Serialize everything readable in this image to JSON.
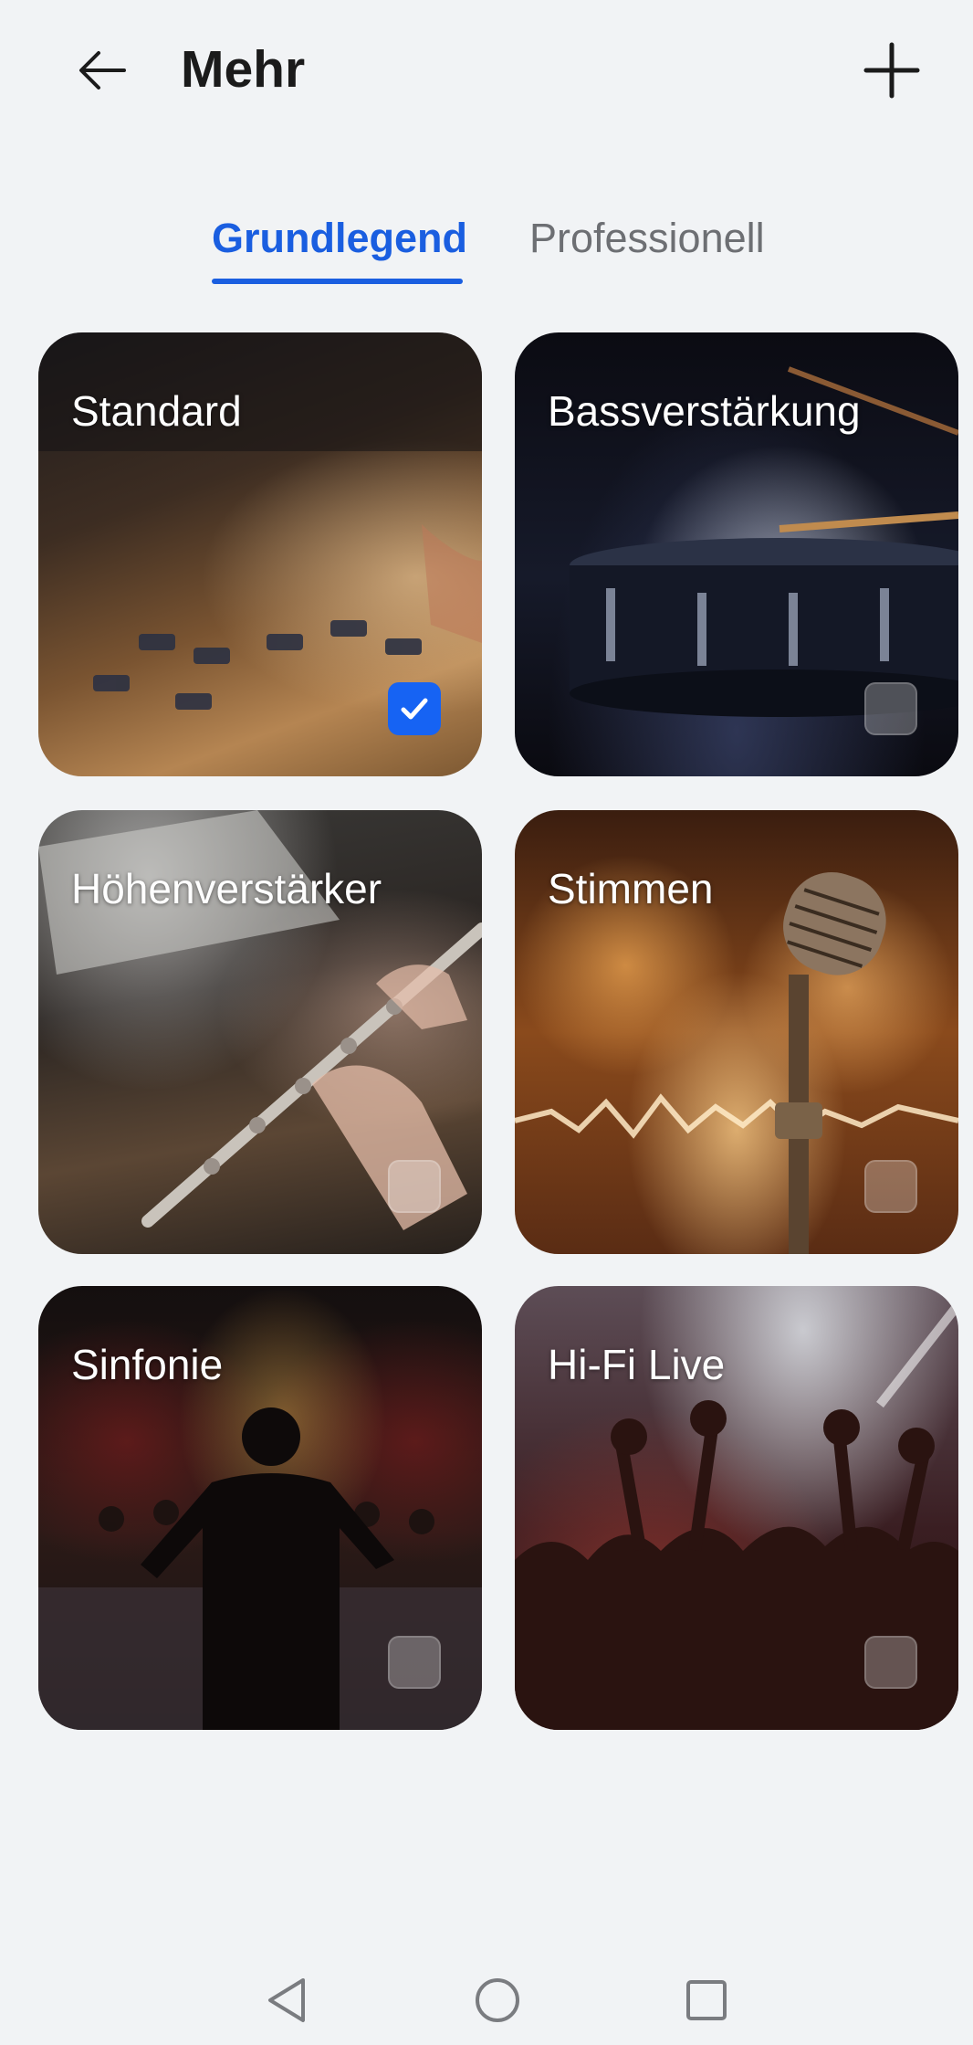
{
  "header": {
    "title": "Mehr",
    "back_icon": "arrow-left-icon",
    "add_icon": "plus-icon"
  },
  "tabs": [
    {
      "label": "Grundlegend",
      "active": true
    },
    {
      "label": "Professionell",
      "active": false
    }
  ],
  "colors": {
    "accent": "#1a5ee0",
    "background": "#f1f3f5",
    "checkbox_active": "#1663f3"
  },
  "presets": [
    {
      "label": "Standard",
      "selected": true
    },
    {
      "label": "Bassverstärkung",
      "selected": false
    },
    {
      "label": "Höhenverstärker",
      "selected": false
    },
    {
      "label": "Stimmen",
      "selected": false
    },
    {
      "label": "Sinfonie",
      "selected": false
    },
    {
      "label": "Hi-Fi Live",
      "selected": false
    }
  ],
  "navbar": {
    "back_icon": "triangle-back-icon",
    "home_icon": "circle-home-icon",
    "recents_icon": "square-recents-icon"
  }
}
